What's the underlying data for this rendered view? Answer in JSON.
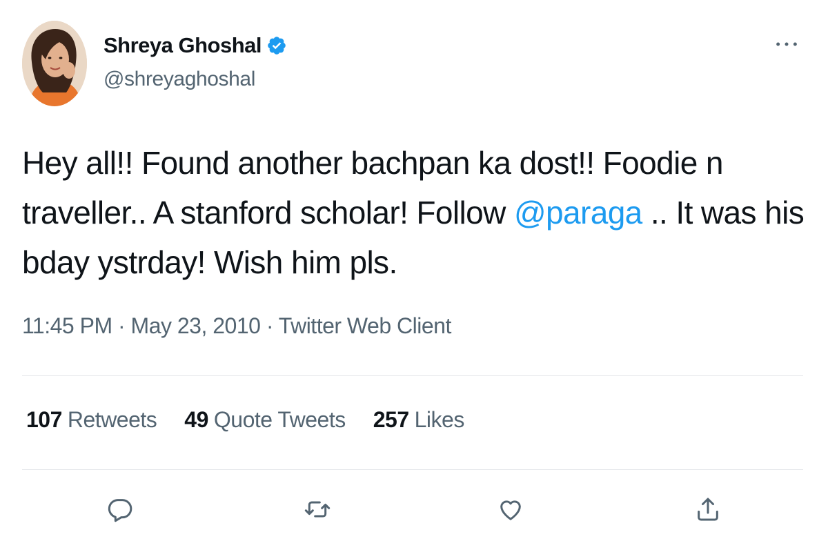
{
  "tweet": {
    "author": {
      "display_name": "Shreya Ghoshal",
      "handle": "@shreyaghoshal",
      "verified": true
    },
    "text_before": "Hey all!! Found another bachpan ka dost!! Foodie n traveller.. A stanford scholar! Follow ",
    "mention": "@paraga",
    "text_after": " .. It was his bday ystrday! Wish him pls.",
    "timestamp": "11:45 PM · May 23, 2010 · Twitter Web Client",
    "stats": {
      "retweets_count": "107",
      "retweets_label": "Retweets",
      "quotes_count": "49",
      "quotes_label": "Quote Tweets",
      "likes_count": "257",
      "likes_label": "Likes"
    },
    "actions": [
      "reply-icon",
      "retweet-icon",
      "like-icon",
      "share-icon"
    ]
  },
  "colors": {
    "text": "#0f1419",
    "secondary": "#536471",
    "accent": "#1d9bf0",
    "divider": "#e4e7ea"
  }
}
